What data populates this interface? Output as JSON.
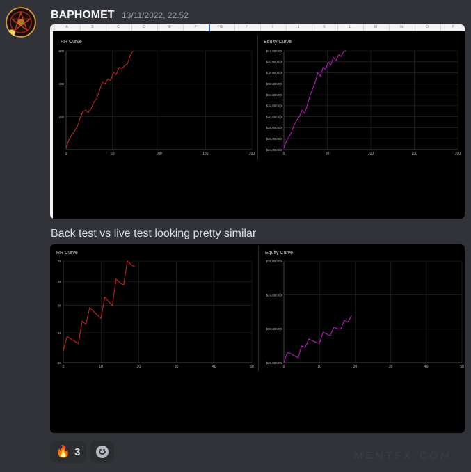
{
  "message": {
    "username": "BAPHOMET",
    "timestamp": "13/11/2022, 22.52",
    "text": "Back test vs live test looking pretty similar"
  },
  "spreadsheet_columns": [
    "A",
    "B",
    "C",
    "D",
    "E",
    "F",
    "G",
    "H",
    "I",
    "J",
    "K",
    "L",
    "M",
    "N",
    "O",
    "P"
  ],
  "attachments": [
    {
      "name": "backtest",
      "charts": [
        {
          "title": "RR Curve",
          "type": "line",
          "color": "#c0261f",
          "xlim": [
            0,
            200
          ],
          "ylim": [
            0,
            600
          ],
          "xticks": [
            0,
            50,
            100,
            150,
            200
          ],
          "xtick_labels": [
            "0",
            "50",
            "100",
            "150",
            "200"
          ],
          "yticks": [
            200,
            400,
            600
          ],
          "ytick_labels": [
            "200",
            "400",
            "600"
          ],
          "series": [
            {
              "x": [
                0,
                3,
                6,
                9,
                12,
                15,
                18,
                21,
                24,
                27,
                30,
                33,
                36,
                39,
                42,
                45,
                48,
                51,
                54,
                57,
                60,
                63,
                66,
                69,
                72
              ],
              "y": [
                10,
                60,
                90,
                110,
                140,
                190,
                230,
                240,
                225,
                250,
                290,
                310,
                360,
                410,
                400,
                430,
                420,
                470,
                455,
                500,
                490,
                510,
                520,
                570,
                600
              ]
            }
          ]
        },
        {
          "title": "Equity Curve",
          "type": "line",
          "color": "#b21fb5",
          "xlim": [
            0,
            200
          ],
          "ylim": [
            24000,
            42000
          ],
          "xticks": [
            0,
            50,
            100,
            150,
            200
          ],
          "xtick_labels": [
            "0",
            "50",
            "100",
            "150",
            "200"
          ],
          "yticks": [
            24000,
            26000,
            28000,
            30000,
            32000,
            34000,
            36000,
            38000,
            40000,
            42000
          ],
          "ytick_labels": [
            "$24,000.00",
            "$26,000.00",
            "$28,000.00",
            "$30,000.00",
            "$32,000.00",
            "$34,000.00",
            "$36,000.00",
            "$38,000.00",
            "$40,000.00",
            "$42,000.00"
          ],
          "series": [
            {
              "x": [
                0,
                3,
                6,
                9,
                12,
                15,
                18,
                21,
                24,
                27,
                30,
                33,
                36,
                39,
                42,
                45,
                48,
                51,
                54,
                57,
                60,
                63,
                66,
                69,
                72
              ],
              "y": [
                24300,
                25600,
                26400,
                27300,
                28600,
                29400,
                30100,
                31200,
                30600,
                32200,
                33800,
                35100,
                36300,
                38000,
                37400,
                39000,
                38600,
                40000,
                39400,
                40800,
                40200,
                41300,
                41000,
                42000,
                42400
              ]
            }
          ]
        }
      ]
    },
    {
      "name": "livetest",
      "charts": [
        {
          "title": "RR Curve",
          "type": "line",
          "color": "#c0261f",
          "xlim": [
            0,
            50
          ],
          "ylim": [
            -10,
            75
          ],
          "xticks": [
            0,
            10,
            20,
            30,
            40,
            50
          ],
          "xtick_labels": [
            "0",
            "10",
            "20",
            "30",
            "40",
            "50"
          ],
          "yticks": [
            -10,
            15,
            38,
            58,
            75
          ],
          "ytick_labels": [
            "-10",
            "15",
            "38",
            "58",
            "75"
          ],
          "series": [
            {
              "x": [
                0,
                1,
                2,
                3,
                4,
                5,
                6,
                7,
                8,
                9,
                10,
                11,
                12,
                13,
                14,
                15,
                16,
                17,
                18,
                19
              ],
              "y": [
                0,
                12,
                10,
                8,
                6,
                25,
                22,
                36,
                33,
                30,
                27,
                45,
                41,
                38,
                60,
                57,
                55,
                76,
                72,
                70
              ]
            }
          ]
        },
        {
          "title": "Equity Curve",
          "type": "line",
          "color": "#b21fb5",
          "xlim": [
            0,
            50
          ],
          "ylim": [
            25000,
            28000
          ],
          "xticks": [
            0,
            10,
            20,
            30,
            40,
            50
          ],
          "xtick_labels": [
            "0",
            "10",
            "20",
            "30",
            "40",
            "50"
          ],
          "yticks": [
            25000,
            26000,
            27000,
            28000
          ],
          "ytick_labels": [
            "$25,000.00",
            "$26,000.00",
            "$27,000.00",
            "$28,000.00"
          ],
          "series": [
            {
              "x": [
                0,
                1,
                2,
                3,
                4,
                5,
                6,
                7,
                8,
                9,
                10,
                11,
                12,
                13,
                14,
                15,
                16,
                17,
                18,
                19
              ],
              "y": [
                24850,
                25300,
                25270,
                25200,
                25150,
                25500,
                25450,
                25700,
                25650,
                25600,
                25580,
                25900,
                25850,
                25800,
                26050,
                26000,
                26000,
                26250,
                26200,
                26400
              ]
            }
          ]
        }
      ]
    }
  ],
  "reactions": [
    {
      "icon": "fire-icon",
      "count": "3"
    }
  ],
  "watermark": "MENTFX.COM"
}
